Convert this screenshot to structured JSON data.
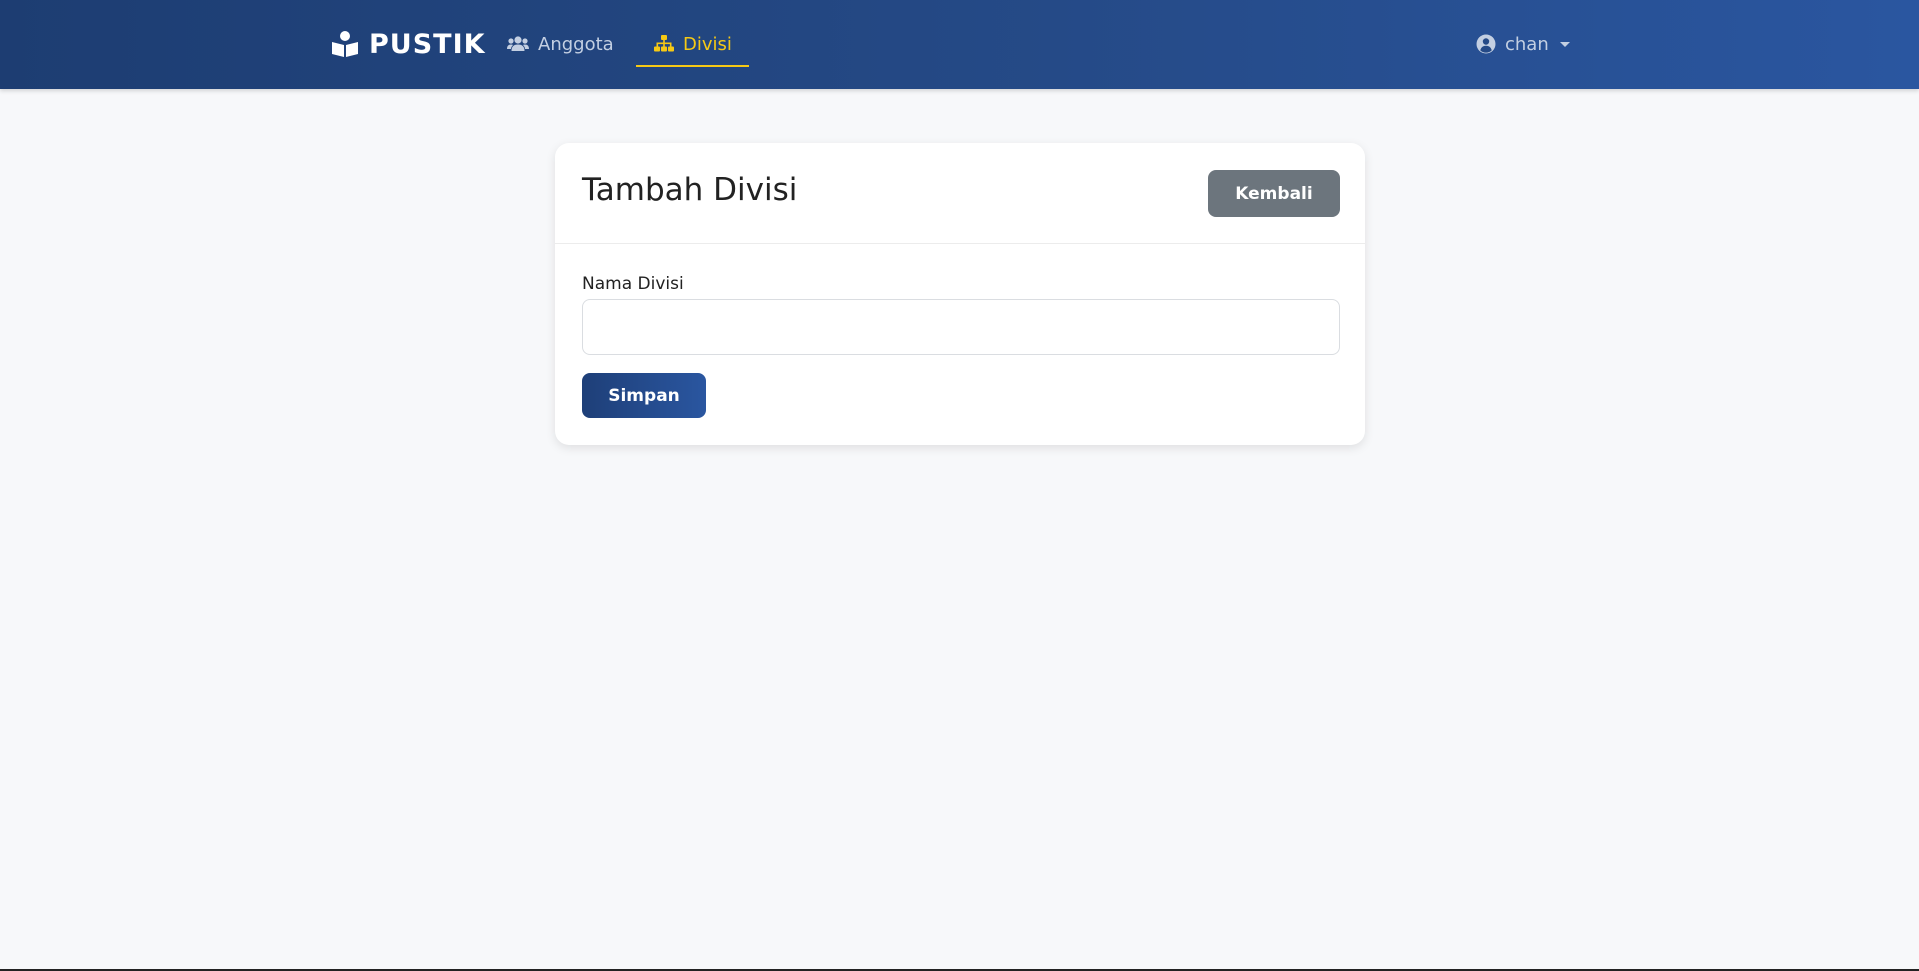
{
  "navbar": {
    "brand": {
      "label": "PUSTIK",
      "icon": "book-reader-icon"
    },
    "links": [
      {
        "label": "Anggota",
        "icon": "users-icon",
        "active": false
      },
      {
        "label": "Divisi",
        "icon": "sitemap-icon",
        "active": true
      }
    ],
    "user": {
      "name": "chan",
      "icon": "user-circle-icon"
    }
  },
  "card": {
    "title": "Tambah Divisi",
    "back_label": "Kembali",
    "field_label": "Nama Divisi",
    "field_value": "",
    "save_label": "Simpan"
  },
  "colors": {
    "navbar": "#254a87",
    "active_link": "#f6c915",
    "back_button": "#6c757d",
    "save_button": "#254a87"
  }
}
